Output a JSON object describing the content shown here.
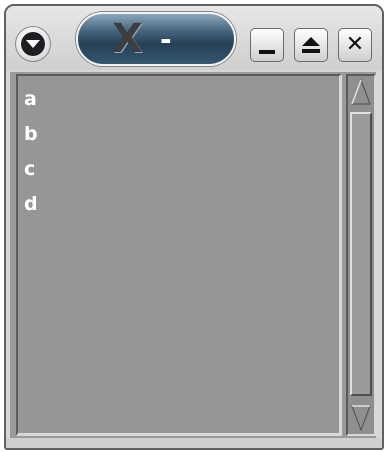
{
  "window": {
    "title": "-",
    "app_icon": "x-logo-icon",
    "colors": {
      "titlebar": "#d7d7d7",
      "title_pill": "#3c5a72",
      "content": "#969696",
      "text": "#ffffff"
    }
  },
  "titlebar": {
    "menu_icon": "chevron-down-icon",
    "minimize_icon": "minimize-icon",
    "maximize_icon": "maximize-icon",
    "close_icon": "close-icon"
  },
  "list": {
    "items": [
      "a",
      "b",
      "c",
      "d"
    ]
  },
  "scrollbar": {
    "up_icon": "arrow-up-icon",
    "down_icon": "arrow-down-icon"
  }
}
